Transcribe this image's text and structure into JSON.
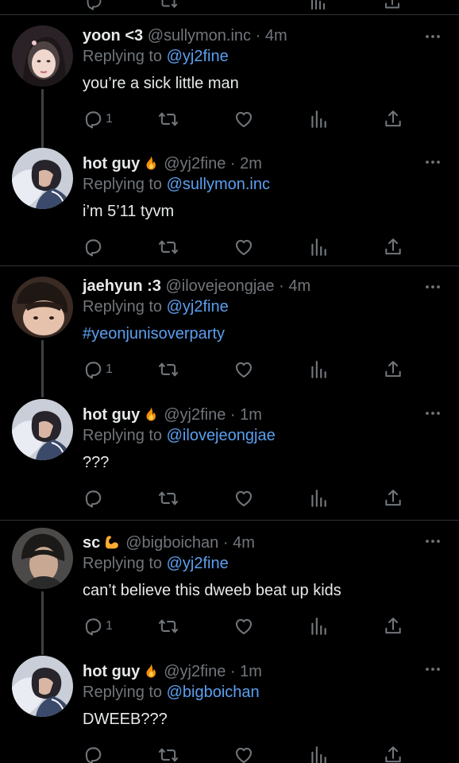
{
  "colors": {
    "background": "#000000",
    "text": "#e7e9ea",
    "secondary": "#71767b",
    "link": "#5b9ff0",
    "divider": "#2f3336"
  },
  "reply_prefix": "Replying to",
  "tweets": [
    {
      "name": "yoon <3",
      "emoji": "",
      "handle": "@sullymon.inc",
      "time": "· 4m",
      "replying_to": "@yj2fine",
      "text": "you’re a sick little man",
      "reply_count": "1",
      "icons": [
        "reply-icon",
        "retweet-icon",
        "like-icon",
        "views-icon",
        "share-icon"
      ]
    },
    {
      "name": "hot guy",
      "emoji": "fire-emoji",
      "handle": "@yj2fine",
      "time": "· 2m",
      "replying_to": "@sullymon.inc",
      "text": "i’m 5’11 tyvm",
      "reply_count": ""
    },
    {
      "name": "jaehyun :3",
      "emoji": "",
      "handle": "@ilovejeongjae",
      "time": "· 4m",
      "replying_to": "@yj2fine",
      "text": "#yeonjunisoverparty",
      "reply_count": "1"
    },
    {
      "name": "hot guy",
      "emoji": "fire-emoji",
      "handle": "@yj2fine",
      "time": "· 1m",
      "replying_to": "@ilovejeongjae",
      "text": "???",
      "reply_count": ""
    },
    {
      "name": "sc",
      "emoji": "flexed-biceps-emoji",
      "handle": "@bigboichan",
      "time": "· 4m",
      "replying_to": "@yj2fine",
      "text": "can’t believe this dweeb beat up kids",
      "reply_count": "1"
    },
    {
      "name": "hot guy",
      "emoji": "fire-emoji",
      "handle": "@yj2fine",
      "time": "· 1m",
      "replying_to": "@bigboichan",
      "text": "DWEEB???",
      "reply_count": ""
    }
  ]
}
